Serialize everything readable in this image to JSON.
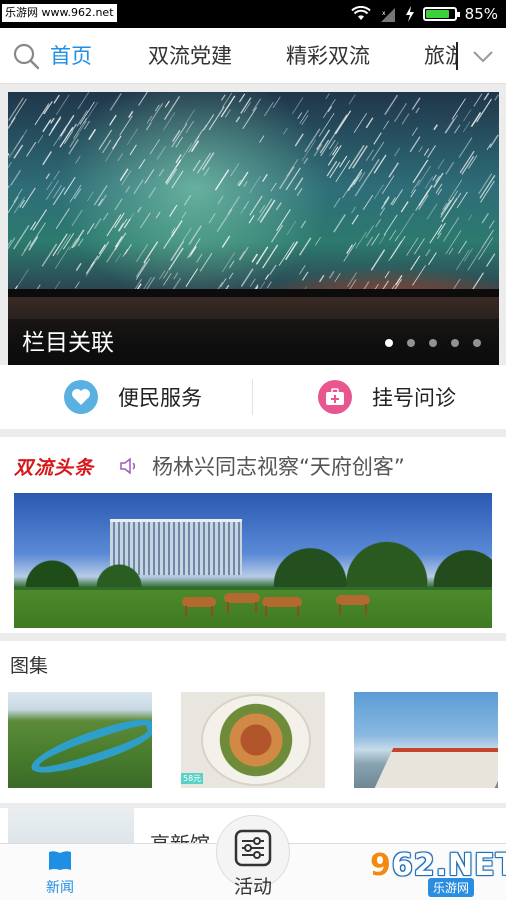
{
  "status_bar": {
    "watermark": "乐游网 www.962.net",
    "battery_percent": "85%",
    "battery_level": 0.85
  },
  "top_nav": {
    "tabs": [
      {
        "label": "首页",
        "active": true
      },
      {
        "label": "双流党建",
        "active": false
      },
      {
        "label": "精彩双流",
        "active": false
      },
      {
        "label": "旅游",
        "active": false
      }
    ]
  },
  "banner": {
    "caption": "栏目关联",
    "dot_count": 5,
    "active_dot": 0
  },
  "services": [
    {
      "label": "便民服务",
      "icon": "heart-chat-icon",
      "color": "#5ab0e0"
    },
    {
      "label": "挂号问诊",
      "icon": "medical-kit-icon",
      "color": "#e8558f"
    }
  ],
  "headline": {
    "logo": "双流头条",
    "text": "杨林兴同志视察“天府创客”"
  },
  "gallery": {
    "title": "图集",
    "images": [
      {
        "icon": "river-town-photo"
      },
      {
        "icon": "food-plate-photo",
        "tag": "58元"
      },
      {
        "icon": "lake-pier-photo"
      }
    ]
  },
  "list": {
    "row_title": "高新馆"
  },
  "bottom_bar": {
    "tabs": [
      {
        "label": "新闻",
        "active": true,
        "icon": "book-icon"
      },
      {
        "label": "活动",
        "active": false,
        "icon": "sliders-icon"
      }
    ]
  },
  "watermark": {
    "logo": "962.NET",
    "site": "乐游网"
  },
  "colors": {
    "accent": "#1f8fe5",
    "headline_red": "#d8171b"
  }
}
